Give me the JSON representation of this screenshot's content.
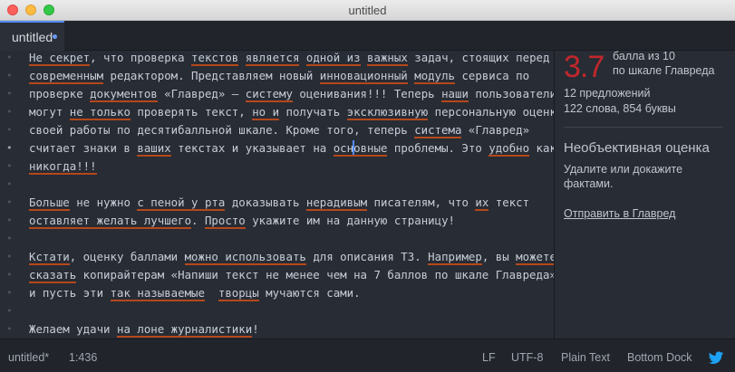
{
  "window": {
    "title": "untitled"
  },
  "tab": {
    "label": "untitled"
  },
  "gutter": {
    "marker": "•"
  },
  "editor": {
    "lines": [
      [
        {
          "t": "Не секрет",
          "u": true
        },
        {
          "t": ", что проверка "
        },
        {
          "t": "текстов",
          "u": true
        },
        {
          "t": " "
        },
        {
          "t": "является",
          "u": true
        },
        {
          "t": " "
        },
        {
          "t": "одной из",
          "u": true
        },
        {
          "t": " "
        },
        {
          "t": "важных",
          "u": true
        },
        {
          "t": " задач, стоящих перед"
        }
      ],
      [
        {
          "t": "современным",
          "u": true
        },
        {
          "t": " редактором. Представляем новый "
        },
        {
          "t": "инновационный",
          "u": true
        },
        {
          "t": " "
        },
        {
          "t": "модуль",
          "u": true
        },
        {
          "t": " сервиса по"
        }
      ],
      [
        {
          "t": "проверке "
        },
        {
          "t": "документов",
          "u": true
        },
        {
          "t": " «Главред» — "
        },
        {
          "t": "систему",
          "u": true
        },
        {
          "t": " оценивания!!! Теперь "
        },
        {
          "t": "наши",
          "u": true
        },
        {
          "t": " пользователи"
        }
      ],
      [
        {
          "t": "могут "
        },
        {
          "t": "не только",
          "u": true
        },
        {
          "t": " проверять текст, "
        },
        {
          "t": "но и",
          "u": true
        },
        {
          "t": " получать "
        },
        {
          "t": "эксклюзивную",
          "u": true
        },
        {
          "t": " персональную оценку"
        }
      ],
      [
        {
          "t": "своей работы по десятибалльной шкале. Кроме того, теперь "
        },
        {
          "t": "система",
          "u": true
        },
        {
          "t": " «Главред»"
        }
      ],
      [
        {
          "t": "считает знаки в "
        },
        {
          "t": "ваших",
          "u": true
        },
        {
          "t": " текстах и указывает на "
        },
        {
          "t": "осн",
          "u": true
        },
        {
          "cursor": true
        },
        {
          "t": "овные",
          "u": true
        },
        {
          "t": " проблемы. Это "
        },
        {
          "t": "удобно",
          "u": true
        },
        {
          "t": " как"
        }
      ],
      [
        {
          "t": "никогда!!!",
          "u": true
        }
      ],
      [],
      [
        {
          "t": "Больше",
          "u": true
        },
        {
          "t": " не нужно "
        },
        {
          "t": "с пеной у рта",
          "u": true
        },
        {
          "t": " доказывать "
        },
        {
          "t": "нерадивым",
          "u": true
        },
        {
          "t": " писателям, что "
        },
        {
          "t": "их",
          "u": true
        },
        {
          "t": " текст"
        }
      ],
      [
        {
          "t": "оставляет желать лучшего",
          "u": true
        },
        {
          "t": ". "
        },
        {
          "t": "Просто",
          "u": true
        },
        {
          "t": " укажите им на данную страницу!"
        }
      ],
      [],
      [
        {
          "t": "Кстати",
          "u": true
        },
        {
          "t": ", оценку баллами "
        },
        {
          "t": "можно использовать",
          "u": true
        },
        {
          "t": " для описания ТЗ. "
        },
        {
          "t": "Например",
          "u": true
        },
        {
          "t": ", вы "
        },
        {
          "t": "можете",
          "u": true
        }
      ],
      [
        {
          "t": "сказать",
          "u": true
        },
        {
          "t": " копирайтерам «Напиши текст не менее чем на 7 баллов по шкале Главреда»,"
        }
      ],
      [
        {
          "t": "и пусть эти "
        },
        {
          "t": "так называемые",
          "u": true
        },
        {
          "t": "  "
        },
        {
          "t": "творцы",
          "u": true
        },
        {
          "t": " мучаются сами."
        }
      ],
      [],
      [
        {
          "t": "Желаем удачи "
        },
        {
          "t": "на лоне журналистики",
          "u": true
        },
        {
          "t": "!"
        }
      ]
    ]
  },
  "panel": {
    "score": "3.7",
    "score_caption_1": "балла из 10",
    "score_caption_2": "по шкале Главреда",
    "sentences": "12 предложений",
    "words_chars": "122 слова, 854 буквы",
    "warning_title": "Необъективная оценка",
    "warning_line_1": "Удалите или докажите",
    "warning_line_2": "фактами.",
    "send_link": "Отправить в Главред"
  },
  "status": {
    "file": "untitled*",
    "position": "1:436",
    "line_ending": "LF",
    "encoding": "UTF-8",
    "grammar": "Plain Text",
    "dock": "Bottom Dock",
    "icon": "bird-icon"
  },
  "colors": {
    "score": "#c1272d",
    "underline": "#b4481b",
    "accent": "#528bff",
    "background": "#282c34"
  }
}
